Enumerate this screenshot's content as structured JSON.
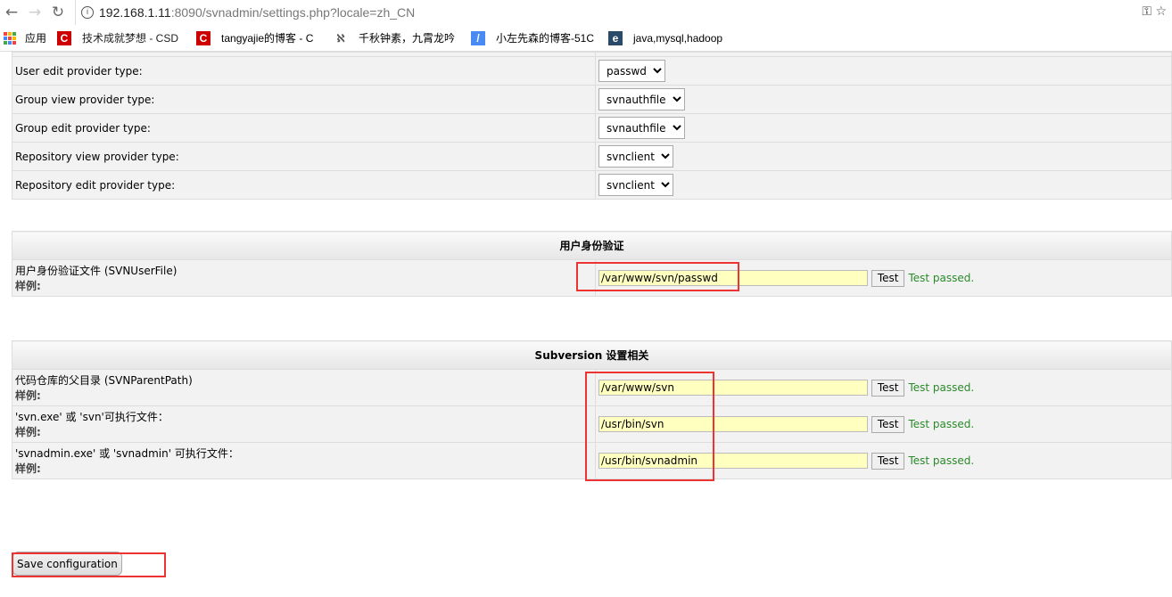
{
  "browser": {
    "url_host": "192.168.1.11",
    "url_rest": ":8090/svnadmin/settings.php?locale=zh_CN",
    "bookmarks": [
      {
        "label": "应用",
        "icon": "apps-icon"
      },
      {
        "label": "技术成就梦想 - CSD",
        "icon": "csdn-icon"
      },
      {
        "label": "tangyajie的博客 - C",
        "icon": "csdn-icon"
      },
      {
        "label": "千秋钟素，九霄龙吟",
        "icon": "blog-icon"
      },
      {
        "label": "小左先森的博客-51C",
        "icon": "feather-icon"
      },
      {
        "label": "java,mysql,hadoop",
        "icon": "site-icon"
      }
    ]
  },
  "providers": [
    {
      "label": "User edit provider type:",
      "value": "passwd"
    },
    {
      "label": "Group view provider type:",
      "value": "svnauthfile"
    },
    {
      "label": "Group edit provider type:",
      "value": "svnauthfile"
    },
    {
      "label": "Repository view provider type:",
      "value": "svnclient"
    },
    {
      "label": "Repository edit provider type:",
      "value": "svnclient"
    }
  ],
  "auth": {
    "title": "用户身份验证",
    "rows": [
      {
        "label": "用户身份验证文件 (SVNUserFile)",
        "example": "样例:",
        "value": "/var/www/svn/passwd",
        "test": "Test",
        "status": "Test passed."
      }
    ]
  },
  "subversion": {
    "title": "Subversion 设置相关",
    "rows": [
      {
        "label": "代码仓库的父目录 (SVNParentPath)",
        "example": "样例:",
        "value": "/var/www/svn",
        "test": "Test",
        "status": "Test passed."
      },
      {
        "label": "'svn.exe' 或 'svn'可执行文件：",
        "example": "样例:",
        "value": "/usr/bin/svn",
        "test": "Test",
        "status": "Test passed."
      },
      {
        "label": "'svnadmin.exe' 或 'svnadmin' 可执行文件：",
        "example": "样例:",
        "value": "/usr/bin/svnadmin",
        "test": "Test",
        "status": "Test passed."
      }
    ]
  },
  "save_label": "Save configuration"
}
